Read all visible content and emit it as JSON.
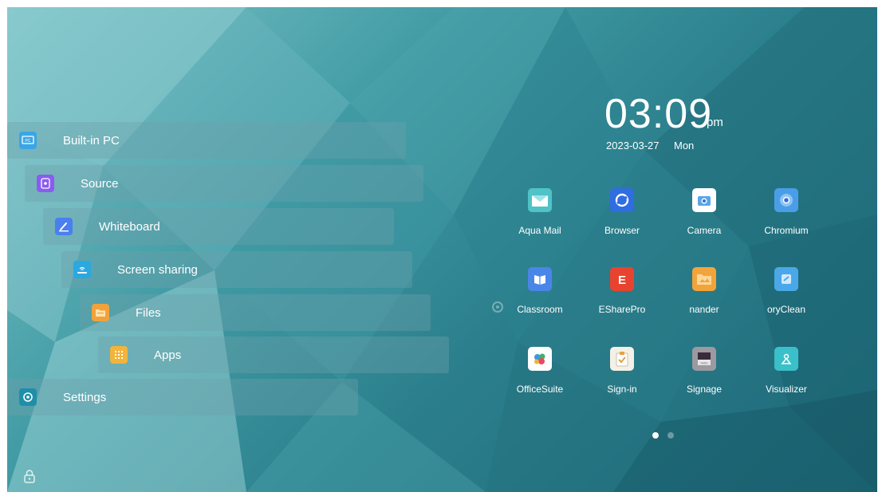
{
  "menu": {
    "items": [
      {
        "label": "Built-in PC",
        "icon": "pc-icon",
        "color": "#3aa6e6"
      },
      {
        "label": "Source",
        "icon": "source-icon",
        "color": "#8a5cf0"
      },
      {
        "label": "Whiteboard",
        "icon": "whiteboard-icon",
        "color": "#4a7ff0"
      },
      {
        "label": "Screen sharing",
        "icon": "screen-sharing-icon",
        "color": "#2aa8e0"
      },
      {
        "label": "Files",
        "icon": "folder-icon",
        "color": "#f2a23a"
      },
      {
        "label": "Apps",
        "icon": "apps-grid-icon",
        "color": "#f2b43a"
      },
      {
        "label": "Settings",
        "icon": "settings-icon",
        "color": "#1f8fa8"
      }
    ]
  },
  "clock": {
    "time": "03:09",
    "ampm": "pm",
    "date": "2023-03-27",
    "day": "Mon"
  },
  "apps": [
    {
      "label": "Aqua Mail",
      "icon": "mail-icon",
      "color": "#4fc3c8"
    },
    {
      "label": "Browser",
      "icon": "browser-icon",
      "color": "#2f6de0"
    },
    {
      "label": "Camera",
      "icon": "camera-icon",
      "color": "#ffffff"
    },
    {
      "label": "Chromium",
      "icon": "chromium-icon",
      "color": "#4a9ee8"
    },
    {
      "label": "Classroom",
      "icon": "classroom-icon",
      "color": "#4a86e8"
    },
    {
      "label": "ESharePro",
      "icon": "eshare-icon",
      "color": "#e8432f"
    },
    {
      "label": "nander",
      "icon": "file-manager-icon",
      "color": "#f2a43a"
    },
    {
      "label": "oryClean",
      "icon": "memory-clean-icon",
      "color": "#4aa8e8"
    },
    {
      "label": "OfficeSuite",
      "icon": "officesuite-icon",
      "color": "#ffffff"
    },
    {
      "label": "Sign-in",
      "icon": "sign-in-icon",
      "color": "#f5f0e6"
    },
    {
      "label": "Signage",
      "icon": "signage-icon",
      "color": "#9a9aa0"
    },
    {
      "label": "Visualizer",
      "icon": "visualizer-icon",
      "color": "#3ac0c8"
    }
  ],
  "pagination": {
    "pages": 2,
    "current": 1
  }
}
